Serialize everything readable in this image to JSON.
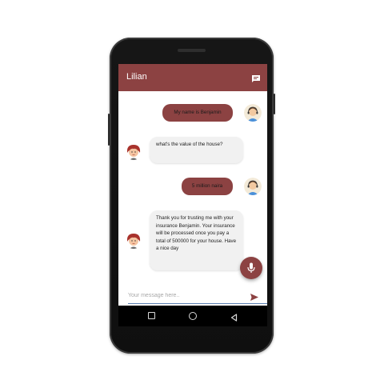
{
  "app": {
    "title": "Lilian"
  },
  "messages": [
    {
      "sender": "user",
      "text": "My name is Benjamin"
    },
    {
      "sender": "bot",
      "text": "what's the value of the house?"
    },
    {
      "sender": "user",
      "text": "5 million naira"
    },
    {
      "sender": "bot",
      "text": "Thank you for trusting me with your insurance Benjamin. Your insurance will be processed once you pay a total of 500000 for your house. Have a nice day"
    }
  ],
  "input": {
    "placeholder": "Your message here.."
  },
  "icons": {
    "appbar_action": "chat-bubble-icon",
    "user_avatar": "user-headset-avatar",
    "bot_avatar": "bot-girl-avatar",
    "fab": "microphone-icon",
    "send": "send-icon",
    "nav": [
      "recent-apps-icon",
      "home-icon",
      "back-icon"
    ]
  },
  "colors": {
    "accent": "#8c4242",
    "bot_bubble": "#f1f1f1",
    "input_line": "#5b7fb0"
  }
}
